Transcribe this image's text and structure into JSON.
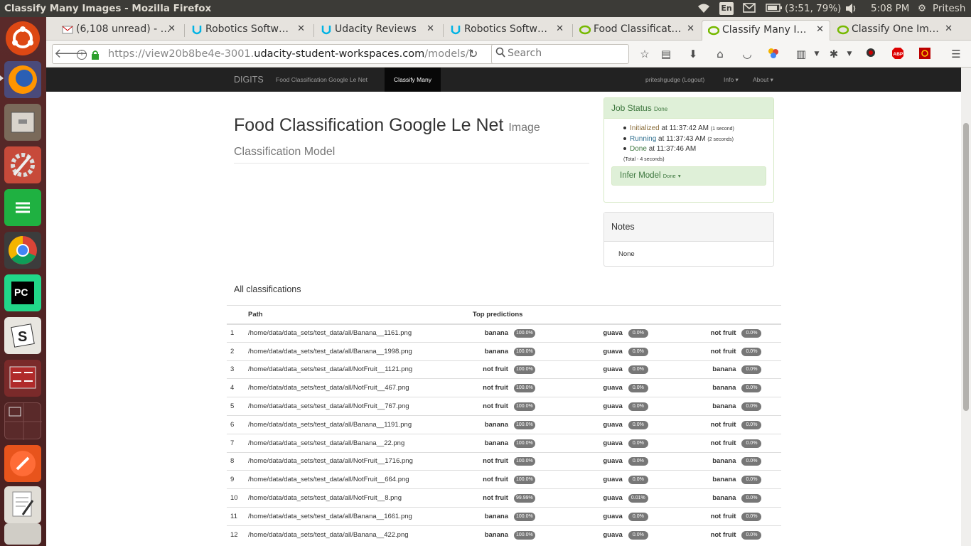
{
  "os": {
    "window_title": "Classify Many Images - Mozilla Firefox",
    "lang": "En",
    "battery": "(3:51, 79%)",
    "clock": "5:08 PM",
    "user": "Pritesh"
  },
  "browser": {
    "tabs": [
      {
        "label": "(6,108 unread) - …",
        "icon": "mail-icon"
      },
      {
        "label": "Robotics Softw…",
        "icon": "udacity-icon"
      },
      {
        "label": "Udacity Reviews",
        "icon": "udacity-icon"
      },
      {
        "label": "Robotics Softw…",
        "icon": "udacity-icon"
      },
      {
        "label": "Food Classificat…",
        "icon": "nvidia-icon"
      },
      {
        "label": "Classify Many I…",
        "icon": "nvidia-icon"
      },
      {
        "label": "Classify One Im…",
        "icon": "nvidia-icon"
      }
    ],
    "url_prefix": "https://view20b8be4e-3001.",
    "url_domain": "udacity-student-workspaces.com",
    "url_suffix": "/models/i",
    "search_placeholder": "Search"
  },
  "digits": {
    "nav": {
      "brand": "DIGITS",
      "model": "Food Classification Google Le Net",
      "current": "Classify Many",
      "user": "priteshgudge (Logout)",
      "info": "Info",
      "about": "About"
    },
    "title": "Food Classification Google Le Net",
    "subtitle": "Image Classification Model",
    "job_status": {
      "heading": "Job Status",
      "state": "Done",
      "entries": [
        {
          "state": "Initialized",
          "time": "at 11:37:42 AM",
          "dur": "(1 second)"
        },
        {
          "state": "Running",
          "time": "at 11:37:43 AM",
          "dur": "(2 seconds)"
        },
        {
          "state": "Done",
          "time": "at 11:37:46 AM",
          "dur": ""
        }
      ],
      "total": "(Total - 4 seconds)",
      "infer_label": "Infer Model",
      "infer_state": "Done"
    },
    "notes": {
      "heading": "Notes",
      "body": "None"
    },
    "section": "All classifications",
    "columns": {
      "path": "Path",
      "top": "Top predictions"
    },
    "rows": [
      {
        "i": "1",
        "path": "/home/data/data_sets/test_data/all/Banana__1161.png",
        "p": [
          [
            "banana",
            "100.0%"
          ],
          [
            "guava",
            "0.0%"
          ],
          [
            "not fruit",
            "0.0%"
          ]
        ]
      },
      {
        "i": "2",
        "path": "/home/data/data_sets/test_data/all/Banana__1998.png",
        "p": [
          [
            "banana",
            "100.0%"
          ],
          [
            "guava",
            "0.0%"
          ],
          [
            "not fruit",
            "0.0%"
          ]
        ]
      },
      {
        "i": "3",
        "path": "/home/data/data_sets/test_data/all/NotFruit__1121.png",
        "p": [
          [
            "not fruit",
            "100.0%"
          ],
          [
            "guava",
            "0.0%"
          ],
          [
            "banana",
            "0.0%"
          ]
        ]
      },
      {
        "i": "4",
        "path": "/home/data/data_sets/test_data/all/NotFruit__467.png",
        "p": [
          [
            "not fruit",
            "100.0%"
          ],
          [
            "guava",
            "0.0%"
          ],
          [
            "banana",
            "0.0%"
          ]
        ]
      },
      {
        "i": "5",
        "path": "/home/data/data_sets/test_data/all/NotFruit__767.png",
        "p": [
          [
            "not fruit",
            "100.0%"
          ],
          [
            "guava",
            "0.0%"
          ],
          [
            "banana",
            "0.0%"
          ]
        ]
      },
      {
        "i": "6",
        "path": "/home/data/data_sets/test_data/all/Banana__1191.png",
        "p": [
          [
            "banana",
            "100.0%"
          ],
          [
            "guava",
            "0.0%"
          ],
          [
            "not fruit",
            "0.0%"
          ]
        ]
      },
      {
        "i": "7",
        "path": "/home/data/data_sets/test_data/all/Banana__22.png",
        "p": [
          [
            "banana",
            "100.0%"
          ],
          [
            "guava",
            "0.0%"
          ],
          [
            "not fruit",
            "0.0%"
          ]
        ]
      },
      {
        "i": "8",
        "path": "/home/data/data_sets/test_data/all/NotFruit__1716.png",
        "p": [
          [
            "not fruit",
            "100.0%"
          ],
          [
            "guava",
            "0.0%"
          ],
          [
            "banana",
            "0.0%"
          ]
        ]
      },
      {
        "i": "9",
        "path": "/home/data/data_sets/test_data/all/NotFruit__664.png",
        "p": [
          [
            "not fruit",
            "100.0%"
          ],
          [
            "guava",
            "0.0%"
          ],
          [
            "banana",
            "0.0%"
          ]
        ]
      },
      {
        "i": "10",
        "path": "/home/data/data_sets/test_data/all/NotFruit__8.png",
        "p": [
          [
            "not fruit",
            "99.99%"
          ],
          [
            "guava",
            "0.01%"
          ],
          [
            "banana",
            "0.0%"
          ]
        ]
      },
      {
        "i": "11",
        "path": "/home/data/data_sets/test_data/all/Banana__1661.png",
        "p": [
          [
            "banana",
            "100.0%"
          ],
          [
            "guava",
            "0.0%"
          ],
          [
            "not fruit",
            "0.0%"
          ]
        ]
      },
      {
        "i": "12",
        "path": "/home/data/data_sets/test_data/all/Banana__422.png",
        "p": [
          [
            "banana",
            "100.0%"
          ],
          [
            "guava",
            "0.0%"
          ],
          [
            "not fruit",
            "0.0%"
          ]
        ]
      }
    ]
  }
}
